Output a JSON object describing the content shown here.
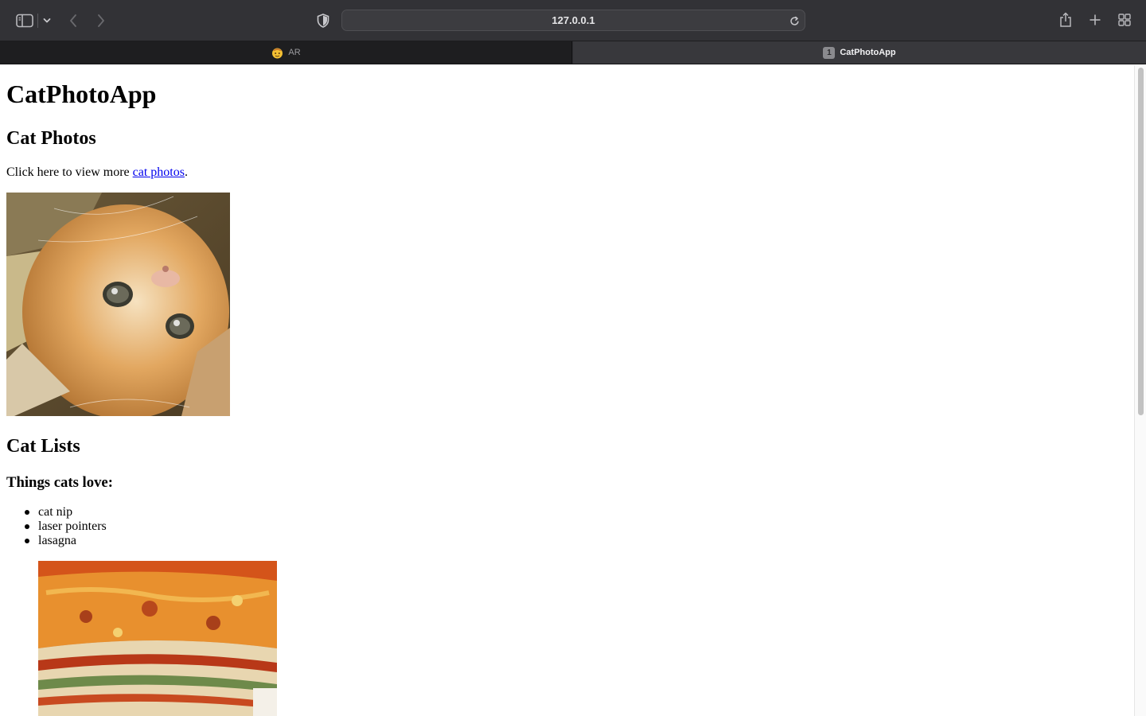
{
  "browser": {
    "address": "127.0.0.1",
    "tabs": [
      {
        "label": "AR",
        "active": false
      },
      {
        "label": "CatPhotoApp",
        "active": true,
        "badge": "1"
      }
    ],
    "icons": {
      "sidebar": "sidebar-icon",
      "chevron": "chevron-down-icon",
      "back": "back-arrow-icon",
      "forward": "forward-arrow-icon",
      "privacy": "shield-icon",
      "reload": "reload-icon",
      "share": "share-icon",
      "new_tab": "plus-icon",
      "tab_overview": "grid-icon"
    },
    "chrome_color": "#323236"
  },
  "page": {
    "title": "CatPhotoApp",
    "section_photos": {
      "heading": "Cat Photos",
      "text_before": "Click here to view more ",
      "link_text": "cat photos",
      "text_after": ".",
      "image_subject": "orange kitten lying upside down"
    },
    "section_lists": {
      "heading": "Cat Lists",
      "subheading": "Things cats love:",
      "items": [
        "cat nip",
        "laser pointers",
        "lasagna"
      ],
      "image_subject": "slice of lasagna"
    },
    "link_color": "#0000ee"
  }
}
